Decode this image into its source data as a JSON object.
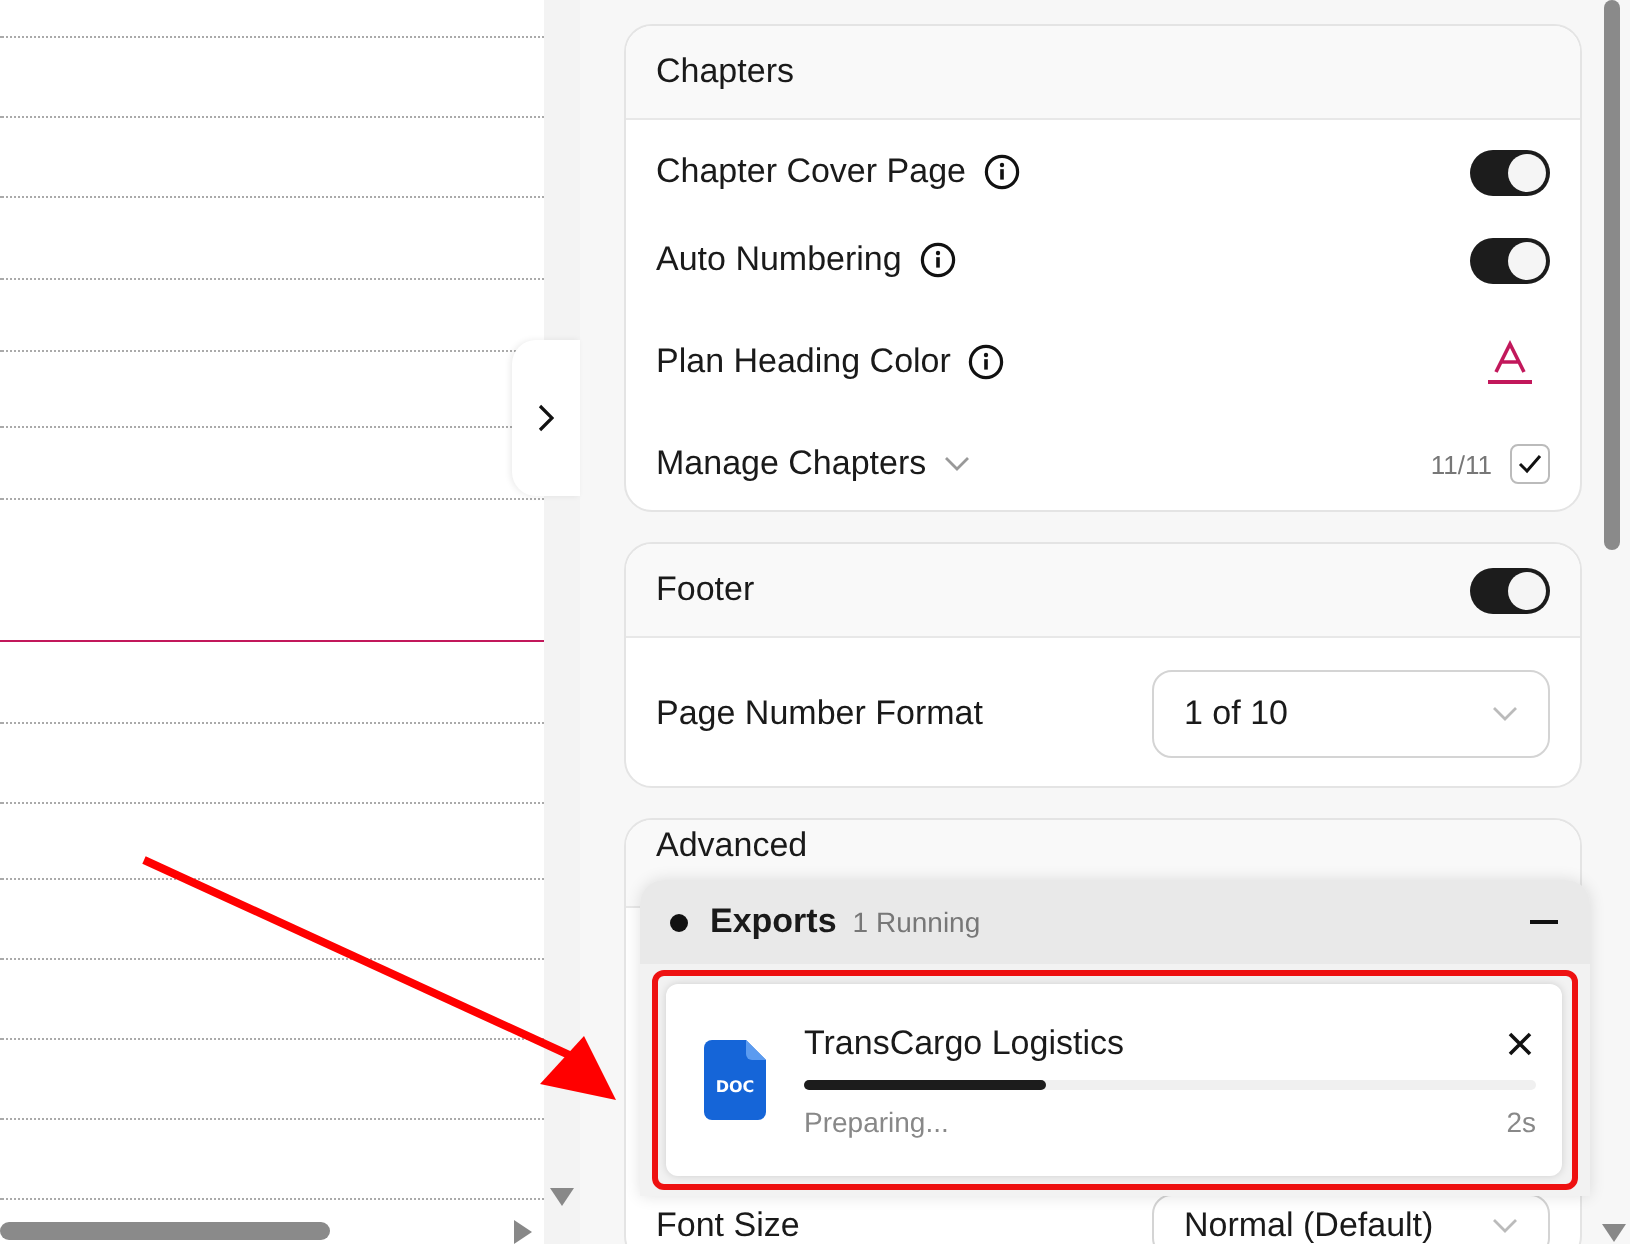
{
  "chapters": {
    "title": "Chapters",
    "rows": [
      {
        "kind": "toggle",
        "label": "Chapter Cover Page",
        "info": true,
        "on": true
      },
      {
        "kind": "toggle",
        "label": "Auto Numbering",
        "info": true,
        "on": true
      },
      {
        "kind": "color",
        "label": "Plan Heading Color",
        "info": true,
        "color": "#c2185b"
      },
      {
        "kind": "manage",
        "label": "Manage Chapters",
        "count": "11/11",
        "checked": true
      }
    ]
  },
  "footer": {
    "title": "Footer",
    "on": true,
    "page_number_format": {
      "label": "Page Number Format",
      "value": "1 of 10"
    }
  },
  "advanced": {
    "title": "Advanced",
    "font_size": {
      "label": "Font Size",
      "value": "Normal (Default)"
    }
  },
  "exports": {
    "title": "Exports",
    "status": "1 Running",
    "items": [
      {
        "file_type": "DOC",
        "name": "TransCargo Logistics",
        "level": 0.33,
        "state": "Preparing...",
        "time": "2s"
      }
    ]
  }
}
